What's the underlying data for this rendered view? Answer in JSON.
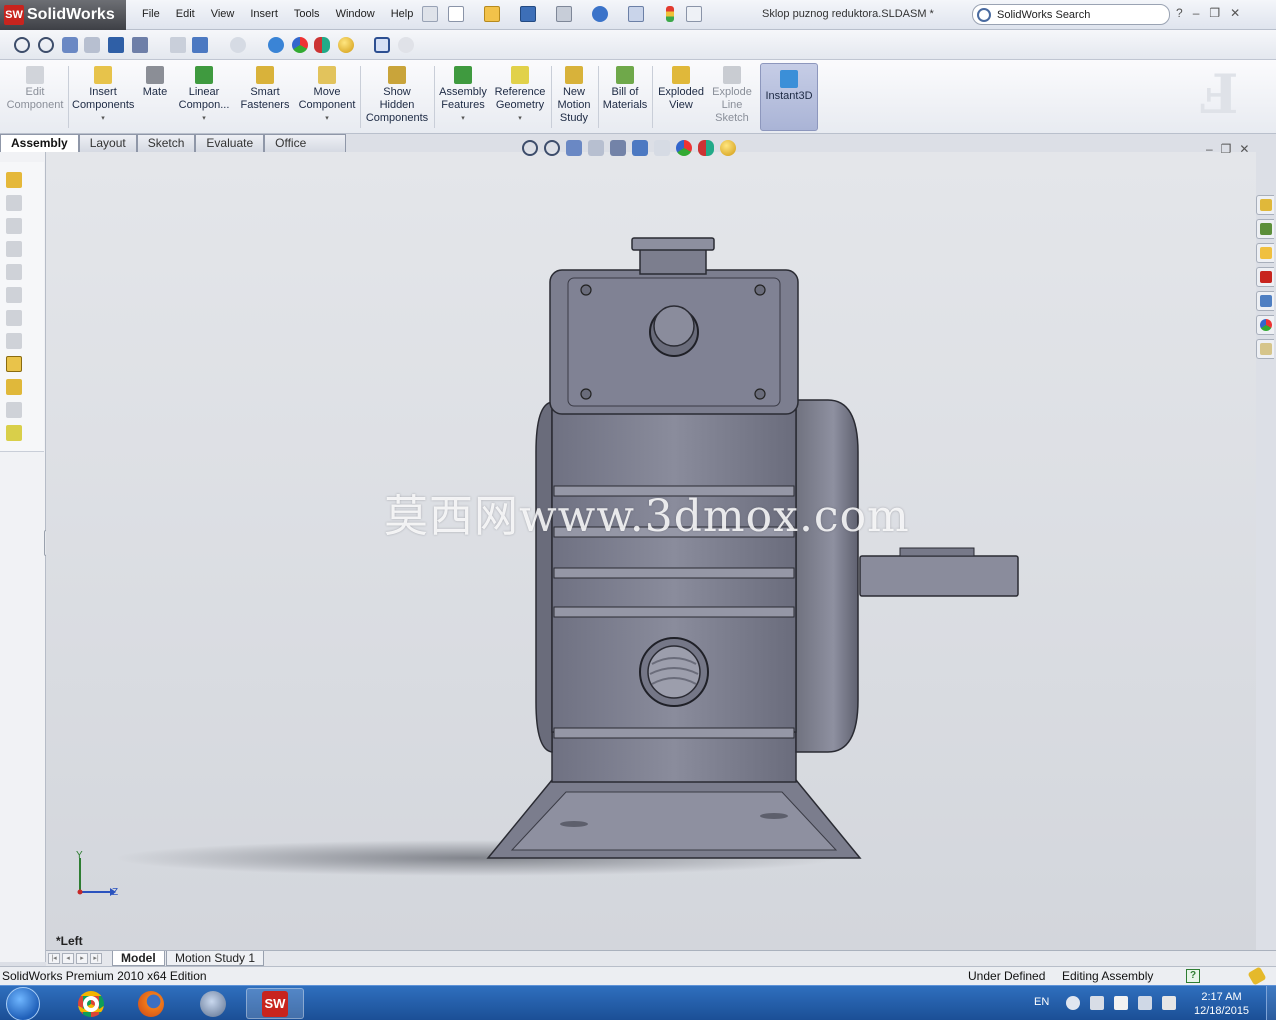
{
  "app": {
    "brand": "SolidWorks",
    "badge": "SW",
    "document_title": "Sklop puznog reduktora.SLDASM *",
    "search_placeholder": "SolidWorks Search"
  },
  "menus": [
    "File",
    "Edit",
    "View",
    "Insert",
    "Tools",
    "Window",
    "Help"
  ],
  "window_controls": [
    "?",
    "–",
    "❐",
    "✕"
  ],
  "command_manager": {
    "edit_component": "Edit\nComponent",
    "insert_components": "Insert\nComponents",
    "mate": "Mate",
    "linear_component": "Linear\nCompon...",
    "smart_fasteners": "Smart\nFasteners",
    "move_component": "Move\nComponent",
    "show_hidden": "Show\nHidden\nComponents",
    "assembly_features": "Assembly\nFeatures",
    "reference_geometry": "Reference\nGeometry",
    "new_motion_study": "New\nMotion\nStudy",
    "bill_of_materials": "Bill of\nMaterials",
    "exploded_view": "Exploded\nView",
    "explode_line_sketch": "Explode\nLine\nSketch",
    "instant3d": "Instant3D"
  },
  "tabs": [
    "Assembly",
    "Layout",
    "Sketch",
    "Evaluate",
    "Office Products"
  ],
  "viewport": {
    "view_label": "*Left",
    "watermark": "莫西网www.3dmox.com",
    "triad": {
      "y": "Y",
      "z": "Z"
    }
  },
  "bottom_tabs": [
    "Model",
    "Motion Study 1"
  ],
  "status": {
    "edition": "SolidWorks Premium 2010 x64 Edition",
    "defined_state": "Under Defined",
    "mode": "Editing Assembly",
    "help": "?"
  },
  "taskbar": {
    "lang": "EN",
    "time": "2:17 AM",
    "date": "12/18/2015",
    "sw_label": "SW"
  },
  "colors": {
    "accent": "#c8241e",
    "model_body": "#7f8192",
    "model_dark": "#5a5c6b",
    "viewport_top": "#e4e6ea",
    "taskbar": "#1b4f96"
  }
}
